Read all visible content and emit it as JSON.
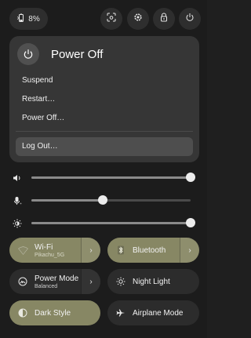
{
  "top_bar": {
    "battery_percent": "8%",
    "icons": [
      "battery-icon",
      "screenshot-icon",
      "settings-icon",
      "lock-icon",
      "power-icon"
    ]
  },
  "power_menu": {
    "title": "Power Off",
    "items": [
      "Suspend",
      "Restart…",
      "Power Off…",
      "Log Out…"
    ],
    "highlighted_item": "Log Out…"
  },
  "sliders": {
    "volume": {
      "icon": "speaker-icon",
      "level": 1.0
    },
    "microphone": {
      "icon": "microphone-icon",
      "level": 0.45
    },
    "brightness": {
      "icon": "brightness-icon",
      "level": 1.0
    }
  },
  "toggles": {
    "wifi": {
      "label": "Wi-Fi",
      "subtitle": "Pikachu_5G",
      "on": true
    },
    "bluetooth": {
      "label": "Bluetooth",
      "on": true
    },
    "power_mode": {
      "label": "Power Mode",
      "subtitle": "Balanced",
      "on": false
    },
    "night_light": {
      "label": "Night Light",
      "on": false
    },
    "dark_style": {
      "label": "Dark Style",
      "on": true
    },
    "airplane_mode": {
      "label": "Airplane Mode",
      "on": false
    }
  },
  "colors": {
    "accent_on": "#878764",
    "menu_bg": "#363636",
    "panel_bg": "#1c1c1c"
  }
}
